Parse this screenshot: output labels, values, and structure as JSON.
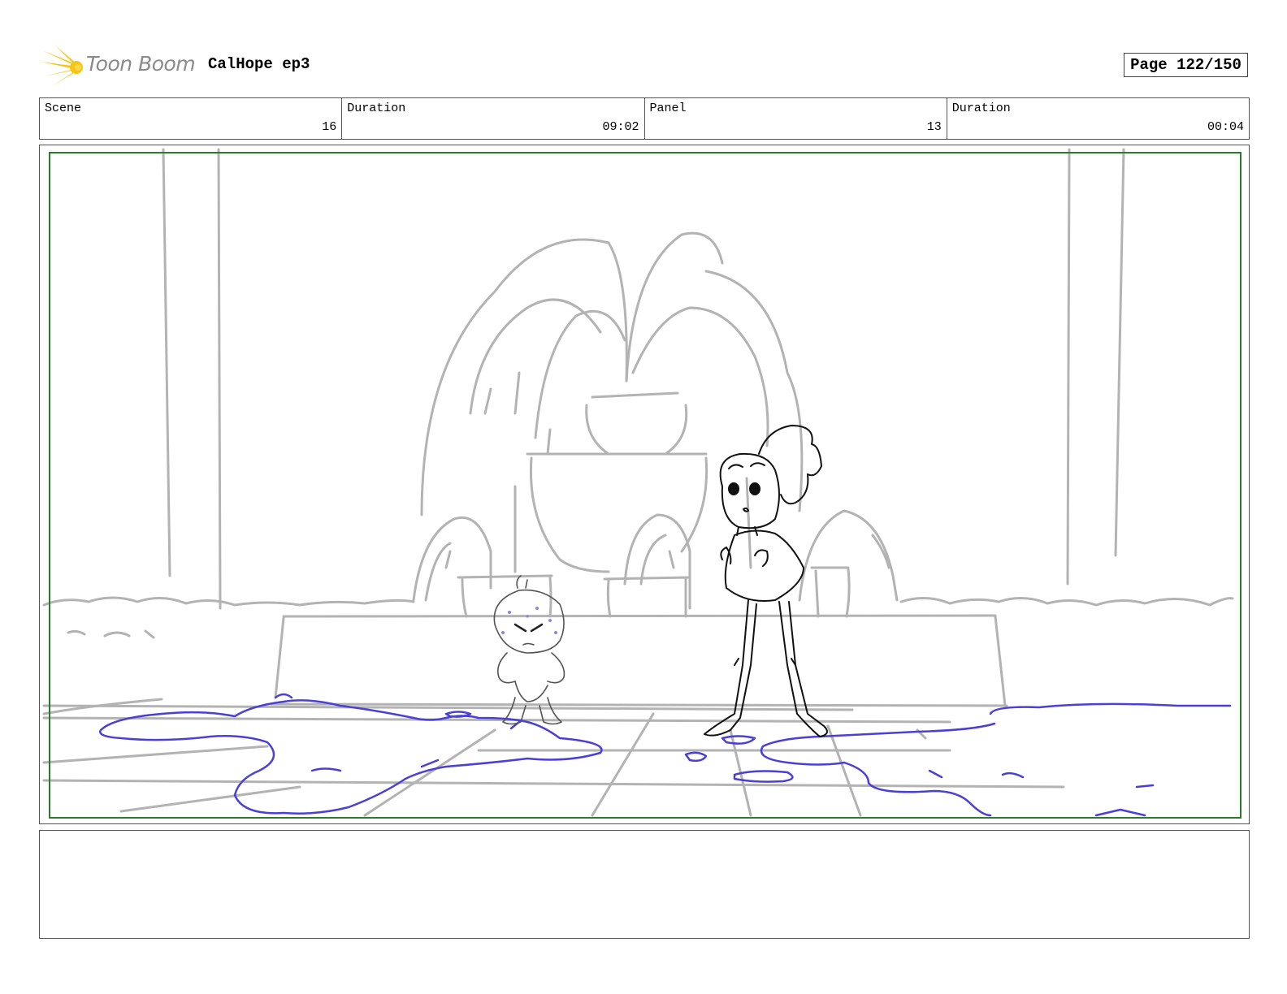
{
  "header": {
    "logo_text": "Toon Boom",
    "project_title": "CalHope ep3",
    "page_label": "Page 122/150"
  },
  "info": {
    "scene_label": "Scene",
    "scene_value": "16",
    "scene_duration_label": "Duration",
    "scene_duration_value": "09:02",
    "panel_label": "Panel",
    "panel_value": "13",
    "panel_duration_label": "Duration",
    "panel_duration_value": "00:04"
  },
  "colors": {
    "sketch_gray": "#b3b3b3",
    "water_blue": "#4a3fd6",
    "safe_frame_green": "#2c7a2c",
    "logo_yellow": "#f5c518"
  },
  "notes": {
    "text": ""
  }
}
